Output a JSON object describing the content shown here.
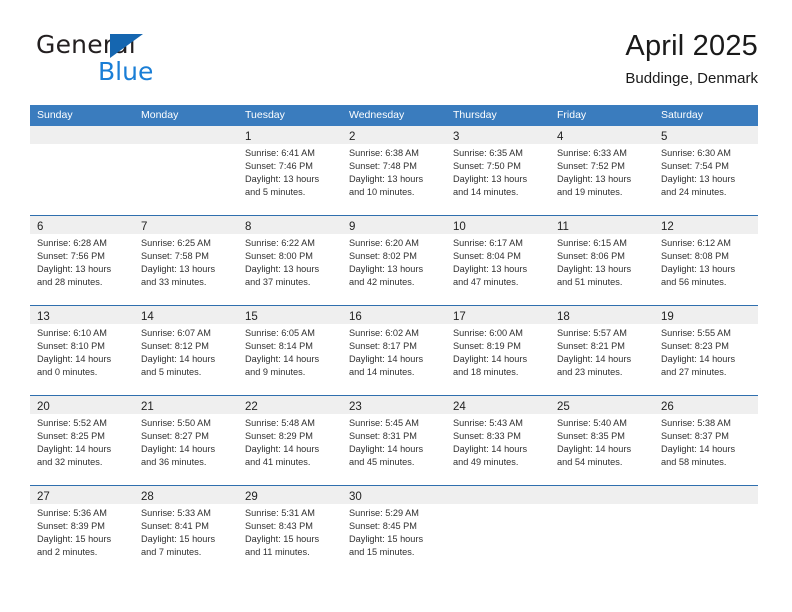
{
  "brand": {
    "name_top": "General",
    "name_bottom": "Blue",
    "accent_color": "#1a7ed6",
    "triangle_color": "#1566b0"
  },
  "header": {
    "title": "April 2025",
    "subtitle": "Buddinge, Denmark"
  },
  "theme": {
    "header_blue": "#3a7cbe",
    "row_divider_blue": "#2f6fae",
    "day_band_gray": "#efefef"
  },
  "weekdays": [
    {
      "label": "Sunday"
    },
    {
      "label": "Monday"
    },
    {
      "label": "Tuesday"
    },
    {
      "label": "Wednesday"
    },
    {
      "label": "Thursday"
    },
    {
      "label": "Friday"
    },
    {
      "label": "Saturday"
    }
  ],
  "labels": {
    "sunrise_prefix": "Sunrise:",
    "sunset_prefix": "Sunset:",
    "daylight_prefix": "Daylight:"
  },
  "weeks": [
    {
      "days": [
        {
          "number": "",
          "sunrise": "",
          "sunset": "",
          "daylight_line1": "",
          "daylight_line2": "",
          "empty": true
        },
        {
          "number": "",
          "sunrise": "",
          "sunset": "",
          "daylight_line1": "",
          "daylight_line2": "",
          "empty": true
        },
        {
          "number": "1",
          "sunrise": "Sunrise: 6:41 AM",
          "sunset": "Sunset: 7:46 PM",
          "daylight_line1": "Daylight: 13 hours",
          "daylight_line2": "and 5 minutes.",
          "empty": false
        },
        {
          "number": "2",
          "sunrise": "Sunrise: 6:38 AM",
          "sunset": "Sunset: 7:48 PM",
          "daylight_line1": "Daylight: 13 hours",
          "daylight_line2": "and 10 minutes.",
          "empty": false
        },
        {
          "number": "3",
          "sunrise": "Sunrise: 6:35 AM",
          "sunset": "Sunset: 7:50 PM",
          "daylight_line1": "Daylight: 13 hours",
          "daylight_line2": "and 14 minutes.",
          "empty": false
        },
        {
          "number": "4",
          "sunrise": "Sunrise: 6:33 AM",
          "sunset": "Sunset: 7:52 PM",
          "daylight_line1": "Daylight: 13 hours",
          "daylight_line2": "and 19 minutes.",
          "empty": false
        },
        {
          "number": "5",
          "sunrise": "Sunrise: 6:30 AM",
          "sunset": "Sunset: 7:54 PM",
          "daylight_line1": "Daylight: 13 hours",
          "daylight_line2": "and 24 minutes.",
          "empty": false
        }
      ]
    },
    {
      "days": [
        {
          "number": "6",
          "sunrise": "Sunrise: 6:28 AM",
          "sunset": "Sunset: 7:56 PM",
          "daylight_line1": "Daylight: 13 hours",
          "daylight_line2": "and 28 minutes.",
          "empty": false
        },
        {
          "number": "7",
          "sunrise": "Sunrise: 6:25 AM",
          "sunset": "Sunset: 7:58 PM",
          "daylight_line1": "Daylight: 13 hours",
          "daylight_line2": "and 33 minutes.",
          "empty": false
        },
        {
          "number": "8",
          "sunrise": "Sunrise: 6:22 AM",
          "sunset": "Sunset: 8:00 PM",
          "daylight_line1": "Daylight: 13 hours",
          "daylight_line2": "and 37 minutes.",
          "empty": false
        },
        {
          "number": "9",
          "sunrise": "Sunrise: 6:20 AM",
          "sunset": "Sunset: 8:02 PM",
          "daylight_line1": "Daylight: 13 hours",
          "daylight_line2": "and 42 minutes.",
          "empty": false
        },
        {
          "number": "10",
          "sunrise": "Sunrise: 6:17 AM",
          "sunset": "Sunset: 8:04 PM",
          "daylight_line1": "Daylight: 13 hours",
          "daylight_line2": "and 47 minutes.",
          "empty": false
        },
        {
          "number": "11",
          "sunrise": "Sunrise: 6:15 AM",
          "sunset": "Sunset: 8:06 PM",
          "daylight_line1": "Daylight: 13 hours",
          "daylight_line2": "and 51 minutes.",
          "empty": false
        },
        {
          "number": "12",
          "sunrise": "Sunrise: 6:12 AM",
          "sunset": "Sunset: 8:08 PM",
          "daylight_line1": "Daylight: 13 hours",
          "daylight_line2": "and 56 minutes.",
          "empty": false
        }
      ]
    },
    {
      "days": [
        {
          "number": "13",
          "sunrise": "Sunrise: 6:10 AM",
          "sunset": "Sunset: 8:10 PM",
          "daylight_line1": "Daylight: 14 hours",
          "daylight_line2": "and 0 minutes.",
          "empty": false
        },
        {
          "number": "14",
          "sunrise": "Sunrise: 6:07 AM",
          "sunset": "Sunset: 8:12 PM",
          "daylight_line1": "Daylight: 14 hours",
          "daylight_line2": "and 5 minutes.",
          "empty": false
        },
        {
          "number": "15",
          "sunrise": "Sunrise: 6:05 AM",
          "sunset": "Sunset: 8:14 PM",
          "daylight_line1": "Daylight: 14 hours",
          "daylight_line2": "and 9 minutes.",
          "empty": false
        },
        {
          "number": "16",
          "sunrise": "Sunrise: 6:02 AM",
          "sunset": "Sunset: 8:17 PM",
          "daylight_line1": "Daylight: 14 hours",
          "daylight_line2": "and 14 minutes.",
          "empty": false
        },
        {
          "number": "17",
          "sunrise": "Sunrise: 6:00 AM",
          "sunset": "Sunset: 8:19 PM",
          "daylight_line1": "Daylight: 14 hours",
          "daylight_line2": "and 18 minutes.",
          "empty": false
        },
        {
          "number": "18",
          "sunrise": "Sunrise: 5:57 AM",
          "sunset": "Sunset: 8:21 PM",
          "daylight_line1": "Daylight: 14 hours",
          "daylight_line2": "and 23 minutes.",
          "empty": false
        },
        {
          "number": "19",
          "sunrise": "Sunrise: 5:55 AM",
          "sunset": "Sunset: 8:23 PM",
          "daylight_line1": "Daylight: 14 hours",
          "daylight_line2": "and 27 minutes.",
          "empty": false
        }
      ]
    },
    {
      "days": [
        {
          "number": "20",
          "sunrise": "Sunrise: 5:52 AM",
          "sunset": "Sunset: 8:25 PM",
          "daylight_line1": "Daylight: 14 hours",
          "daylight_line2": "and 32 minutes.",
          "empty": false
        },
        {
          "number": "21",
          "sunrise": "Sunrise: 5:50 AM",
          "sunset": "Sunset: 8:27 PM",
          "daylight_line1": "Daylight: 14 hours",
          "daylight_line2": "and 36 minutes.",
          "empty": false
        },
        {
          "number": "22",
          "sunrise": "Sunrise: 5:48 AM",
          "sunset": "Sunset: 8:29 PM",
          "daylight_line1": "Daylight: 14 hours",
          "daylight_line2": "and 41 minutes.",
          "empty": false
        },
        {
          "number": "23",
          "sunrise": "Sunrise: 5:45 AM",
          "sunset": "Sunset: 8:31 PM",
          "daylight_line1": "Daylight: 14 hours",
          "daylight_line2": "and 45 minutes.",
          "empty": false
        },
        {
          "number": "24",
          "sunrise": "Sunrise: 5:43 AM",
          "sunset": "Sunset: 8:33 PM",
          "daylight_line1": "Daylight: 14 hours",
          "daylight_line2": "and 49 minutes.",
          "empty": false
        },
        {
          "number": "25",
          "sunrise": "Sunrise: 5:40 AM",
          "sunset": "Sunset: 8:35 PM",
          "daylight_line1": "Daylight: 14 hours",
          "daylight_line2": "and 54 minutes.",
          "empty": false
        },
        {
          "number": "26",
          "sunrise": "Sunrise: 5:38 AM",
          "sunset": "Sunset: 8:37 PM",
          "daylight_line1": "Daylight: 14 hours",
          "daylight_line2": "and 58 minutes.",
          "empty": false
        }
      ]
    },
    {
      "days": [
        {
          "number": "27",
          "sunrise": "Sunrise: 5:36 AM",
          "sunset": "Sunset: 8:39 PM",
          "daylight_line1": "Daylight: 15 hours",
          "daylight_line2": "and 2 minutes.",
          "empty": false
        },
        {
          "number": "28",
          "sunrise": "Sunrise: 5:33 AM",
          "sunset": "Sunset: 8:41 PM",
          "daylight_line1": "Daylight: 15 hours",
          "daylight_line2": "and 7 minutes.",
          "empty": false
        },
        {
          "number": "29",
          "sunrise": "Sunrise: 5:31 AM",
          "sunset": "Sunset: 8:43 PM",
          "daylight_line1": "Daylight: 15 hours",
          "daylight_line2": "and 11 minutes.",
          "empty": false
        },
        {
          "number": "30",
          "sunrise": "Sunrise: 5:29 AM",
          "sunset": "Sunset: 8:45 PM",
          "daylight_line1": "Daylight: 15 hours",
          "daylight_line2": "and 15 minutes.",
          "empty": false
        },
        {
          "number": "",
          "sunrise": "",
          "sunset": "",
          "daylight_line1": "",
          "daylight_line2": "",
          "empty": true
        },
        {
          "number": "",
          "sunrise": "",
          "sunset": "",
          "daylight_line1": "",
          "daylight_line2": "",
          "empty": true
        },
        {
          "number": "",
          "sunrise": "",
          "sunset": "",
          "daylight_line1": "",
          "daylight_line2": "",
          "empty": true
        }
      ]
    }
  ]
}
